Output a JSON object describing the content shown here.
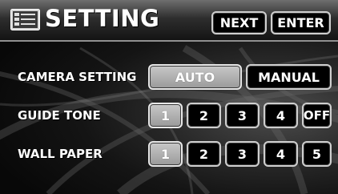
{
  "header": {
    "title": "SETTING",
    "next_label": "NEXT",
    "enter_label": "ENTER"
  },
  "rows": {
    "camera": {
      "label": "CAMERA SETTING",
      "options": [
        "AUTO",
        "MANUAL"
      ],
      "selected": "AUTO"
    },
    "guide_tone": {
      "label": "GUIDE TONE",
      "options": [
        "1",
        "2",
        "3",
        "4",
        "OFF"
      ],
      "selected": "1"
    },
    "wall_paper": {
      "label": "WALL PAPER",
      "options": [
        "1",
        "2",
        "3",
        "4",
        "5"
      ],
      "selected": "1"
    }
  },
  "icons": {
    "header_icon": "menu-list-icon"
  },
  "colors": {
    "selected_fill": "#b0b0b0",
    "button_border": "#cfcfcf",
    "text": "#ffffff"
  }
}
